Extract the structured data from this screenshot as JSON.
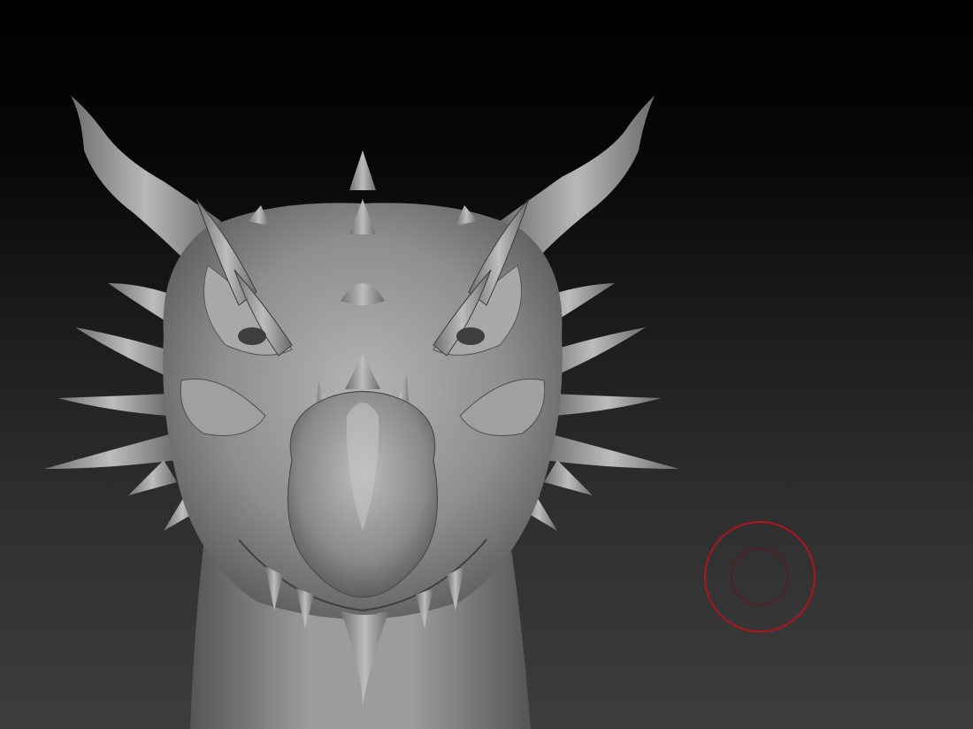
{
  "viewport": {
    "background_top": "#000000",
    "background_bottom": "#3d3d3d"
  },
  "model": {
    "name": "dragon-head-sculpt",
    "material_color": "#9a9a9a",
    "shadow_color": "#4a4a4a",
    "highlight_color": "#c8c8c8"
  },
  "brush_cursor": {
    "icon": "brush-cursor-icon",
    "color": "#b0141c"
  }
}
